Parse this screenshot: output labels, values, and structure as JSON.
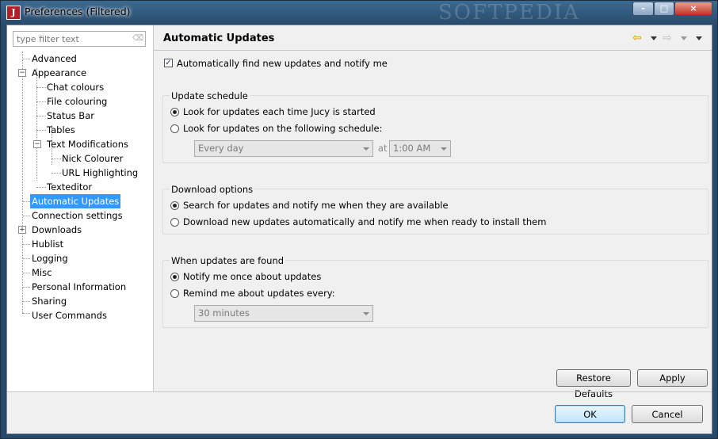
{
  "window": {
    "title": "Preferences (Filtered)",
    "app_icon": "J",
    "watermark": "SOFTPEDIA",
    "controls": {
      "minimize": "-",
      "maximize": "□",
      "close": "×"
    }
  },
  "filter": {
    "placeholder": "type filter text"
  },
  "tree": {
    "advanced": "Advanced",
    "appearance": "Appearance",
    "chat_colours": "Chat colours",
    "file_colouring": "File colouring",
    "status_bar": "Status Bar",
    "tables": "Tables",
    "text_modifications": "Text Modifications",
    "nick_colourer": "Nick Colourer",
    "url_highlighting": "URL Highlighting",
    "texteditor": "Texteditor",
    "automatic_updates": "Automatic Updates",
    "connection_settings": "Connection settings",
    "downloads": "Downloads",
    "hublist": "Hublist",
    "logging": "Logging",
    "misc": "Misc",
    "personal_information": "Personal Information",
    "sharing": "Sharing",
    "user_commands": "User Commands"
  },
  "page": {
    "title": "Automatic Updates",
    "auto_find": {
      "label": "Automatically find new updates and notify me",
      "checked": true
    },
    "schedule": {
      "title": "Update schedule",
      "option_startup": "Look for updates each time Jucy is started",
      "option_schedule": "Look for updates on the following schedule:",
      "day_value": "Every day",
      "at_label": "at",
      "time_value": "1:00 AM"
    },
    "download": {
      "title": "Download options",
      "option_notify": "Search for updates and notify me when they are available",
      "option_auto": "Download new updates automatically and notify me when ready to install them"
    },
    "found": {
      "title": "When updates are found",
      "option_once": "Notify me once about updates",
      "option_remind": "Remind me about updates every:",
      "remind_value": "30 minutes"
    },
    "restore_defaults": "Restore Defaults",
    "apply": "Apply"
  },
  "dialog": {
    "ok": "OK",
    "cancel": "Cancel"
  },
  "icons": {
    "back": "⇦",
    "forward": "⇨",
    "check": "✓",
    "expand": "+",
    "collapse": "−",
    "clear": "⌫"
  }
}
